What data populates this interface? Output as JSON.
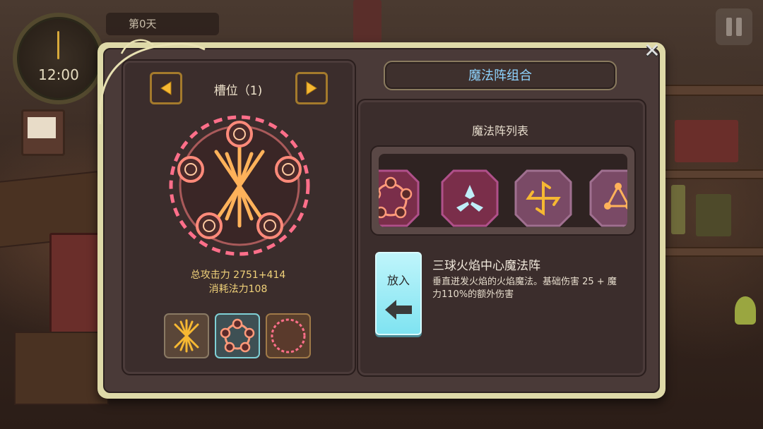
{
  "hud": {
    "clock_time": "12:00",
    "day_label": "第0天"
  },
  "dialog": {
    "title": "魔法阵组合",
    "close_symbol": "✕",
    "slot_title": "槽位（1)",
    "total_attack": "总攻击力 2751+414",
    "mana_cost": "消耗法力108",
    "list_title": "魔法阵列表",
    "put_button_label": "放入",
    "spell_name": "三球火焰中心魔法阵",
    "spell_description": "垂直迸发火焰的火焰魔法。基础伤害 25 + 魔力110%的额外伤害"
  },
  "slot_icons": [
    {
      "name": "slot-icon-slash",
      "icon": "star-burst-icon"
    },
    {
      "name": "slot-icon-orbs",
      "icon": "orb-ring-icon",
      "selected": true
    },
    {
      "name": "slot-icon-empty",
      "icon": "dashed-circle-icon"
    }
  ],
  "spell_list": [
    {
      "icon": "orb-ring-icon",
      "style": "magenta"
    },
    {
      "icon": "tri-blade-icon",
      "style": "magenta"
    },
    {
      "icon": "spiral-flame-icon",
      "style": "purple"
    },
    {
      "icon": "triangle-orbs-icon",
      "style": "purple"
    }
  ],
  "colors": {
    "accent_gold": "#f4b23a",
    "title_blue": "#8fd4ff",
    "put_button": "#8fe8f4",
    "circle_pink": "#ff6f8a"
  }
}
